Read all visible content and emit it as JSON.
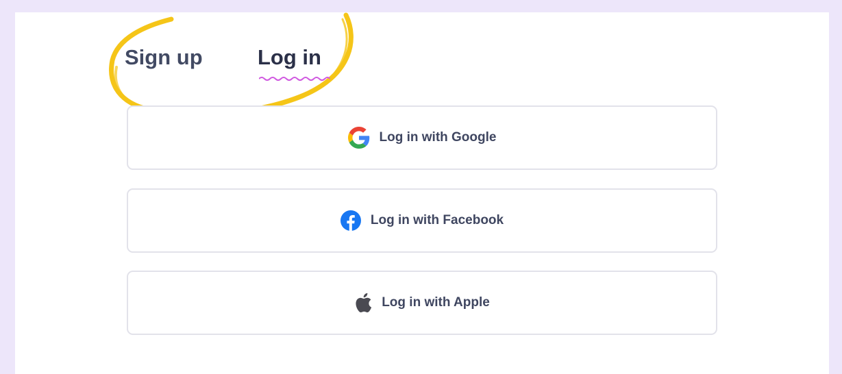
{
  "tabs": {
    "signup_label": "Sign up",
    "login_label": "Log in",
    "active": "login"
  },
  "buttons": {
    "google": {
      "label": "Log in with Google",
      "icon": "google-icon"
    },
    "facebook": {
      "label": "Log in with Facebook",
      "icon": "facebook-icon"
    },
    "apple": {
      "label": "Log in with Apple",
      "icon": "apple-icon"
    }
  },
  "colors": {
    "background": "#ede6fa",
    "panel": "#ffffff",
    "tab_text": "#424a63",
    "active_underline": "#d05ae0",
    "highlight_circle": "#f5c518",
    "button_border": "#e2e2ea",
    "facebook_blue": "#1877f2"
  }
}
